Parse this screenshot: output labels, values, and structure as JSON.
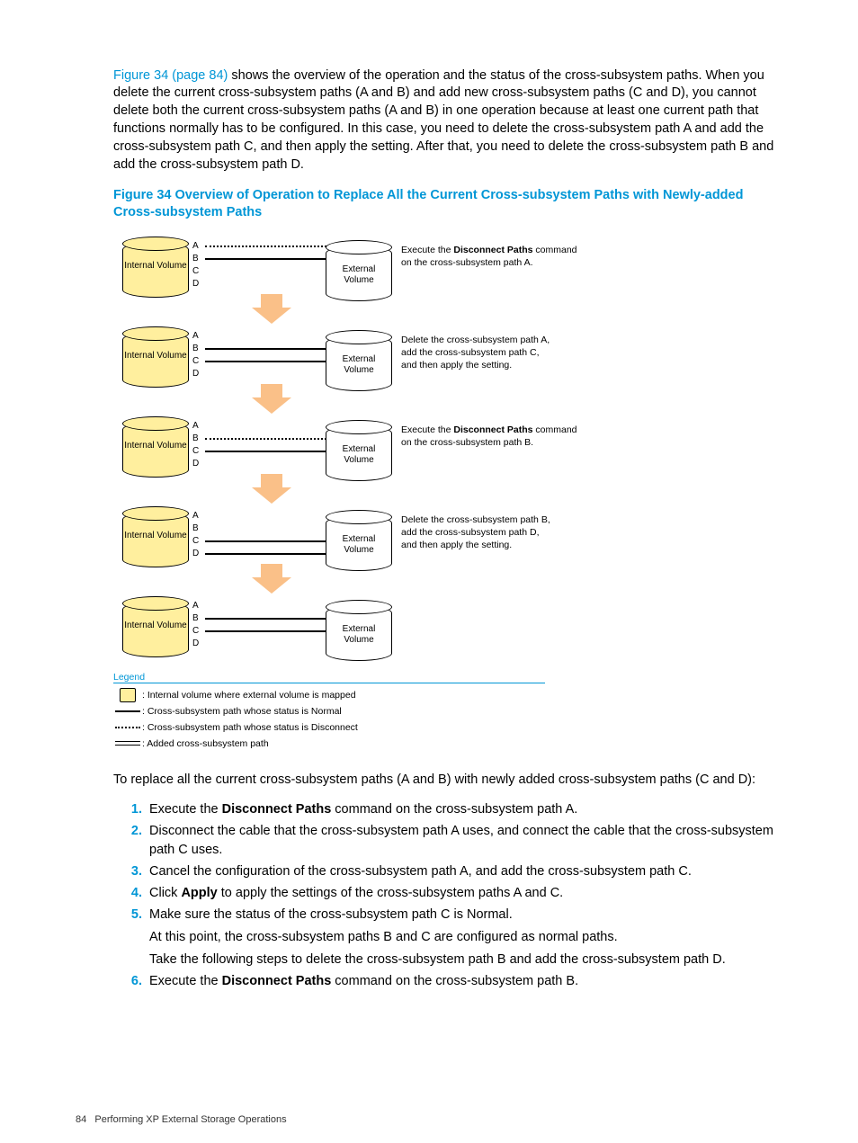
{
  "intro": {
    "link": "Figure 34 (page 84)",
    "rest": " shows the overview of the operation and the status of the cross-subsystem paths. When you delete the current cross-subsystem paths (A and B) and add new cross-subsystem paths (C and D), you cannot delete both the current cross-subsystem paths (A and B) in one operation because at least one current path that functions normally has to be configured. In this case, you need to delete the cross-subsystem path A and add the cross-subsystem path C, and then apply the setting. After that, you need to delete the cross-subsystem path B and add the cross-subsystem path D."
  },
  "caption": "Figure 34 Overview of Operation to Replace All the Current Cross-subsystem Paths with Newly-added Cross-subsystem Paths",
  "volumes": {
    "internal": "Internal\nVolume",
    "external": "External\nVolume"
  },
  "path_labels": [
    "A",
    "B",
    "C",
    "D"
  ],
  "stages": [
    {
      "paths": [
        "dotted",
        "solid",
        "none",
        "none"
      ],
      "desc_pre": "Execute the ",
      "desc_bold": "Disconnect Paths",
      "desc_post": " command\non the cross-subsystem path A.",
      "arrow": true
    },
    {
      "paths": [
        "none",
        "solid",
        "double",
        "none"
      ],
      "desc_pre": "",
      "desc_bold": "",
      "desc_post": "Delete the cross-subsystem path A,\nadd the cross-subsystem path C,\nand then apply the setting.",
      "arrow": true
    },
    {
      "paths": [
        "none",
        "dotted",
        "solid",
        "none"
      ],
      "desc_pre": "Execute the ",
      "desc_bold": "Disconnect Paths",
      "desc_post": " command\non the cross-subsystem path B.",
      "arrow": true
    },
    {
      "paths": [
        "none",
        "none",
        "solid",
        "double"
      ],
      "desc_pre": "",
      "desc_bold": "",
      "desc_post": "Delete the cross-subsystem path B,\nadd the cross-subsystem path D,\nand then apply the setting.",
      "arrow": true
    },
    {
      "paths": [
        "none",
        "solid",
        "solid",
        "none"
      ],
      "desc_pre": "",
      "desc_bold": "",
      "desc_post": "",
      "arrow": false
    }
  ],
  "legend": {
    "title": "Legend",
    "items": [
      ": Internal volume where external volume is mapped",
      ": Cross-subsystem path whose status is Normal",
      ": Cross-subsystem path whose status is Disconnect",
      ": Added cross-subsystem path"
    ]
  },
  "after_fig": "To replace all the current cross-subsystem paths (A and B) with newly added cross-subsystem paths (C and D):",
  "steps": {
    "s1_pre": "Execute the ",
    "s1_bold": "Disconnect Paths",
    "s1_post": " command on the cross-subsystem path A.",
    "s2": "Disconnect the cable that the cross-subsystem path A uses, and connect the cable that the cross-subsystem path C uses.",
    "s3": "Cancel the configuration of the cross-subsystem path A, and add the cross-subsystem path C.",
    "s4_pre": "Click ",
    "s4_bold": "Apply",
    "s4_post": " to apply the settings of the cross-subsystem paths A and C.",
    "s5a": "Make sure the status of the cross-subsystem path C is Normal.",
    "s5b": "At this point, the cross-subsystem paths B and C are configured as normal paths.",
    "s5c": "Take the following steps to delete the cross-subsystem path B and add the cross-subsystem path D.",
    "s6_pre": "Execute the ",
    "s6_bold": "Disconnect Paths",
    "s6_post": " command on the cross-subsystem path B."
  },
  "footer": {
    "page": "84",
    "title": "Performing XP External Storage Operations"
  }
}
